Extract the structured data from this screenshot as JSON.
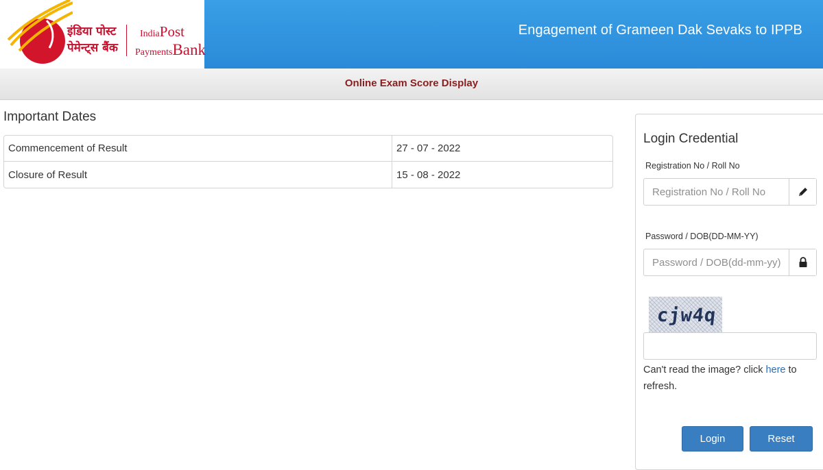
{
  "header": {
    "logo_hindi_line1": "इंडिया पोस्ट",
    "logo_hindi_line2": "पेमेन्ट्स बैंक",
    "logo_en_india": "India",
    "logo_en_post": "Post",
    "logo_en_payments": "Payments",
    "logo_en_bank": "Bank",
    "title": "Engagement of Grameen Dak Sevaks to IPPB"
  },
  "subheader": {
    "title": "Online Exam Score Display"
  },
  "dates": {
    "heading": "Important Dates",
    "rows": [
      {
        "label": "Commencement of Result",
        "value": "27 - 07 - 2022"
      },
      {
        "label": "Closure of Result",
        "value": "15 - 08 - 2022"
      }
    ]
  },
  "login": {
    "title": "Login Credential",
    "reg_label": "Registration No / Roll No",
    "reg_placeholder": "Registration No / Roll No",
    "pwd_label": "Password / DOB(DD-MM-YY)",
    "pwd_placeholder": "Password / DOB(dd-mm-yy)",
    "captcha_text": "cjw4q",
    "refresh_prefix": "Can't read the image? click ",
    "refresh_link": "here",
    "refresh_suffix": " to refresh.",
    "login_button": "Login",
    "reset_button": "Reset"
  },
  "colors": {
    "header_blue": "#2a8ad8",
    "brand_red": "#c8102e",
    "subheader_text": "#8a1e1e",
    "button_blue": "#3a7ec2",
    "link_blue": "#2a6fb7"
  },
  "icons": {
    "reg_addon": "pencil-icon",
    "pwd_addon": "lock-icon"
  }
}
